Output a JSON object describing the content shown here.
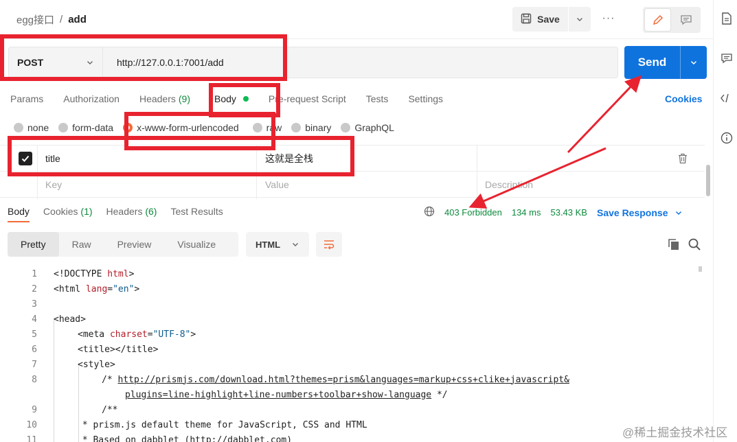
{
  "breadcrumb": {
    "parent": "egg接口",
    "separator": "/",
    "current": "add"
  },
  "header": {
    "save_label": "Save",
    "more_label": "···"
  },
  "request": {
    "method": "POST",
    "url": "http://127.0.0.1:7001/add",
    "send_label": "Send"
  },
  "request_tabs": [
    {
      "label": "Params"
    },
    {
      "label": "Authorization"
    },
    {
      "label": "Headers",
      "count": "(9)"
    },
    {
      "label": "Body"
    },
    {
      "label": "Pre-request Script"
    },
    {
      "label": "Tests"
    },
    {
      "label": "Settings"
    }
  ],
  "cookies_label": "Cookies",
  "body_types": [
    {
      "label": "none"
    },
    {
      "label": "form-data"
    },
    {
      "label": "x-www-form-urlencoded",
      "selected": true
    },
    {
      "label": "raw"
    },
    {
      "label": "binary"
    },
    {
      "label": "GraphQL"
    }
  ],
  "params_table": {
    "rows": [
      {
        "checked": true,
        "key": "title",
        "value": "这就是全栈",
        "description": ""
      }
    ],
    "placeholders": {
      "key": "Key",
      "value": "Value",
      "description": "Description"
    }
  },
  "response_tabs": [
    {
      "label": "Body",
      "count": ""
    },
    {
      "label": "Cookies",
      "count": "(1)"
    },
    {
      "label": "Headers",
      "count": "(6)"
    },
    {
      "label": "Test Results",
      "count": ""
    }
  ],
  "response_status": {
    "status": "403 Forbidden",
    "time": "134 ms",
    "size": "53.43 KB",
    "save_label": "Save Response"
  },
  "view_tabs": [
    "Pretty",
    "Raw",
    "Preview",
    "Visualize"
  ],
  "format": "HTML",
  "code_lines": [
    {
      "n": "1"
    },
    {
      "n": "2"
    },
    {
      "n": "3"
    },
    {
      "n": "4"
    },
    {
      "n": "5"
    },
    {
      "n": "6"
    },
    {
      "n": "7"
    },
    {
      "n": "8"
    },
    {
      "n": ""
    },
    {
      "n": "9"
    },
    {
      "n": "10"
    },
    {
      "n": "11"
    }
  ],
  "code_text": {
    "doctype_open": "<!DOCTYPE ",
    "doctype_kw": "html",
    "doctype_close": ">",
    "html_open": "<html ",
    "html_attr": "lang",
    "html_eq": "=",
    "html_val": "\"en\"",
    "html_close": ">",
    "head": "<head>",
    "meta_open": "<meta ",
    "meta_attr": "charset",
    "meta_eq": "=",
    "meta_val": "\"UTF-8\"",
    "meta_close": ">",
    "title": "<title></title>",
    "style": "<style>",
    "comment_start": "/* ",
    "comment_url": "http://prismjs.com/download.html?themes=prism&languages=markup+css+clike+javascript&",
    "comment_url2": "plugins=line-highlight+line-numbers+toolbar+show-language",
    "comment_end": " */",
    "doc_start": "/**",
    "doc_line1": " * prism.js default theme for JavaScript, CSS and HTML",
    "doc_line2": " * Based on dabblet (http://dabblet.com)"
  },
  "watermark": "@稀土掘金技术社区",
  "colors": {
    "send": "#0f73de",
    "accent": "#f26b3a",
    "success": "#0c8a3c",
    "annotation": "#e8232f"
  }
}
